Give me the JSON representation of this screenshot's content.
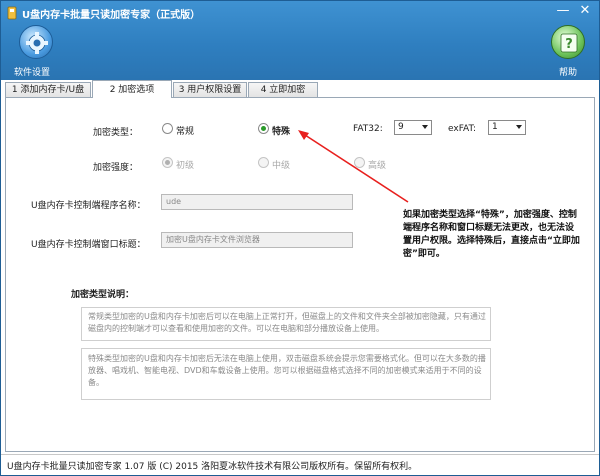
{
  "window": {
    "title": "U盘内存卡批量只读加密专家（正式版）",
    "minimize_glyph": "—",
    "close_glyph": "✕"
  },
  "toolbar": {
    "settings_label": "软件设置",
    "help_label": "帮助",
    "settings_icon": "gear-icon",
    "help_icon": "help-icon"
  },
  "tabs": [
    {
      "label": "1 添加内存卡/U盘"
    },
    {
      "label": "2 加密选项"
    },
    {
      "label": "3 用户权限设置"
    },
    {
      "label": "4 立即加密"
    }
  ],
  "active_tab": 1,
  "encryption": {
    "type_label": "加密类型：",
    "normal_label": "常规",
    "special_label": "特殊",
    "selected": "special",
    "fat32_label": "FAT32:",
    "fat32_value": "9",
    "exfat_label": "exFAT:",
    "exfat_value": "1",
    "strength_label": "加密强度：",
    "strength_low": "初级",
    "strength_mid": "中级",
    "strength_high": "高级",
    "strength_selected": "low"
  },
  "fields": {
    "program_name_label": "U盘内存卡控制端程序名称：",
    "program_name_value": "ude",
    "window_title_label": "U盘内存卡控制端窗口标题：",
    "window_title_value": "加密U盘内存卡文件浏览器"
  },
  "annotation": {
    "text": "如果加密类型选择“特殊”，加密强度、控制端程序名称和窗口标题无法更改，也无法设置用户权限。选择特殊后，直接点击“立即加密”即可。",
    "arrow_color": "#e8201e"
  },
  "description": {
    "heading": "加密类型说明：",
    "normal_text": "常规类型加密的U盘和内存卡加密后可以在电脑上正常打开，但磁盘上的文件和文件夹全部被加密隐藏，只有通过磁盘内的控制端才可以查看和使用加密的文件。可以在电脑和部分播放设备上使用。",
    "special_text": "特殊类型加密的U盘和内存卡加密后无法在电脑上使用，双击磁盘系统会提示您需要格式化。但可以在大多数的播放器、唱戏机、智能电视、DVD和车载设备上使用。您可以根据磁盘格式选择不同的加密模式来适用于不同的设备。"
  },
  "footer": {
    "text": "U盘内存卡批量只读加密专家 1.07 版 (C) 2015 洛阳夏冰软件技术有限公司版权所有。保留所有权利。"
  }
}
